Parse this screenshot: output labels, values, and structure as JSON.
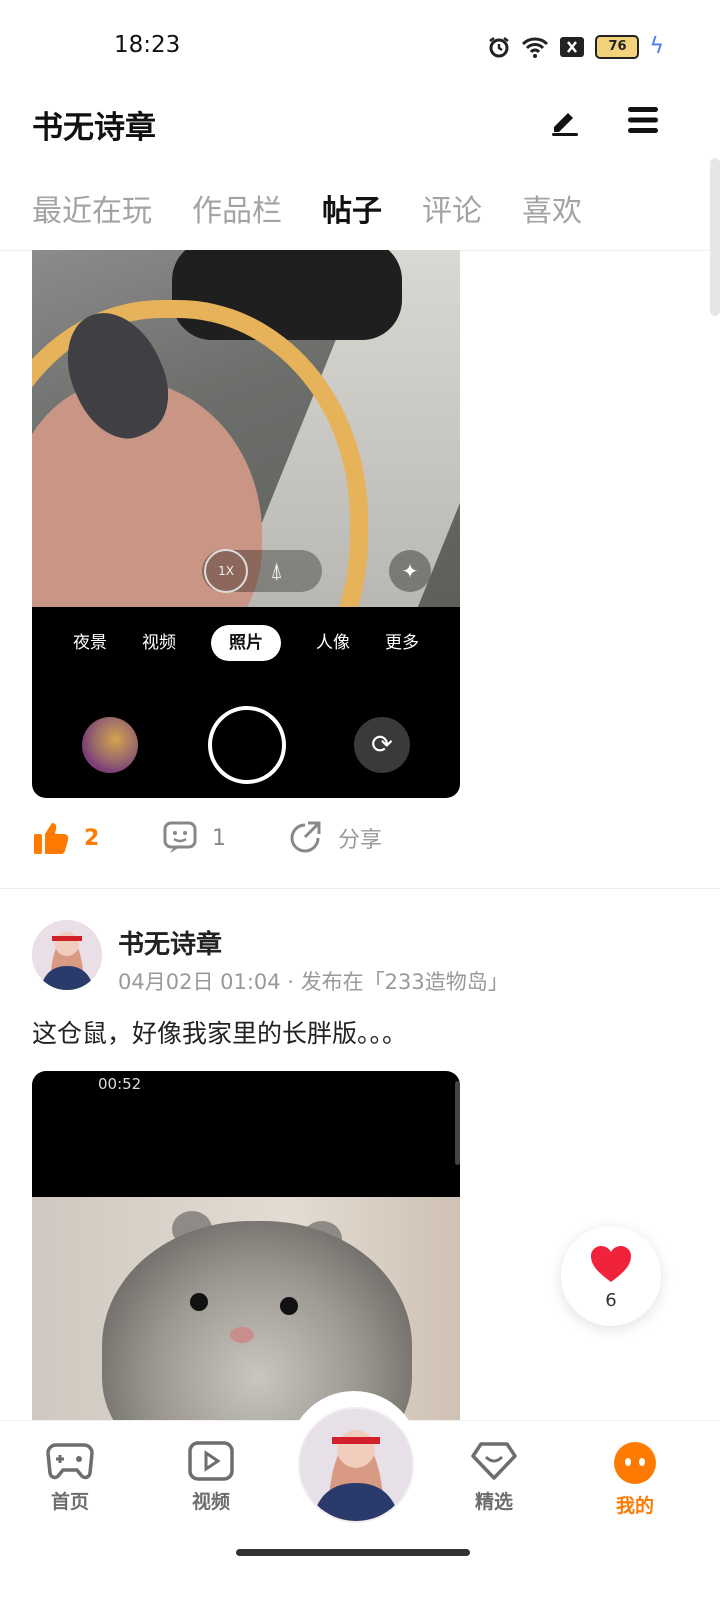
{
  "status_bar": {
    "time": "18:23",
    "battery": "76",
    "icons": [
      "alarm-icon",
      "wifi-icon",
      "sim-blocked-icon",
      "battery-icon",
      "charging-icon"
    ]
  },
  "header": {
    "title": "书无诗章",
    "buttons": [
      "edit-icon",
      "menu-icon"
    ]
  },
  "tabs": [
    {
      "label": "最近在玩",
      "active": false
    },
    {
      "label": "作品栏",
      "active": false
    },
    {
      "label": "帖子",
      "active": true
    },
    {
      "label": "评论",
      "active": false
    },
    {
      "label": "喜欢",
      "active": false
    }
  ],
  "post1": {
    "camera": {
      "zoom": "1X",
      "modes": [
        "夜景",
        "视频",
        "照片",
        "人像",
        "更多"
      ],
      "selected_mode": "照片"
    },
    "likes": "2",
    "comments": "1",
    "share_label": "分享"
  },
  "post2": {
    "author": "书无诗章",
    "meta": "04月02日 01:04 · 发布在「233造物岛」",
    "text": "这仓鼠，好像我家里的长胖版。。。",
    "video_duration": "00:52"
  },
  "like_fab": {
    "count": "6"
  },
  "bottom_nav": [
    {
      "label": "首页",
      "icon": "gamepad-icon",
      "active": false
    },
    {
      "label": "视频",
      "icon": "video-play-icon",
      "active": false
    },
    {
      "label": "",
      "icon": "center-avatar",
      "active": false
    },
    {
      "label": "精选",
      "icon": "heart-diamond-icon",
      "active": false
    },
    {
      "label": "我的",
      "icon": "profile-face-icon",
      "active": true
    }
  ],
  "colors": {
    "accent": "#ff7a00",
    "text": "#111111",
    "muted": "#a3a3a3"
  }
}
